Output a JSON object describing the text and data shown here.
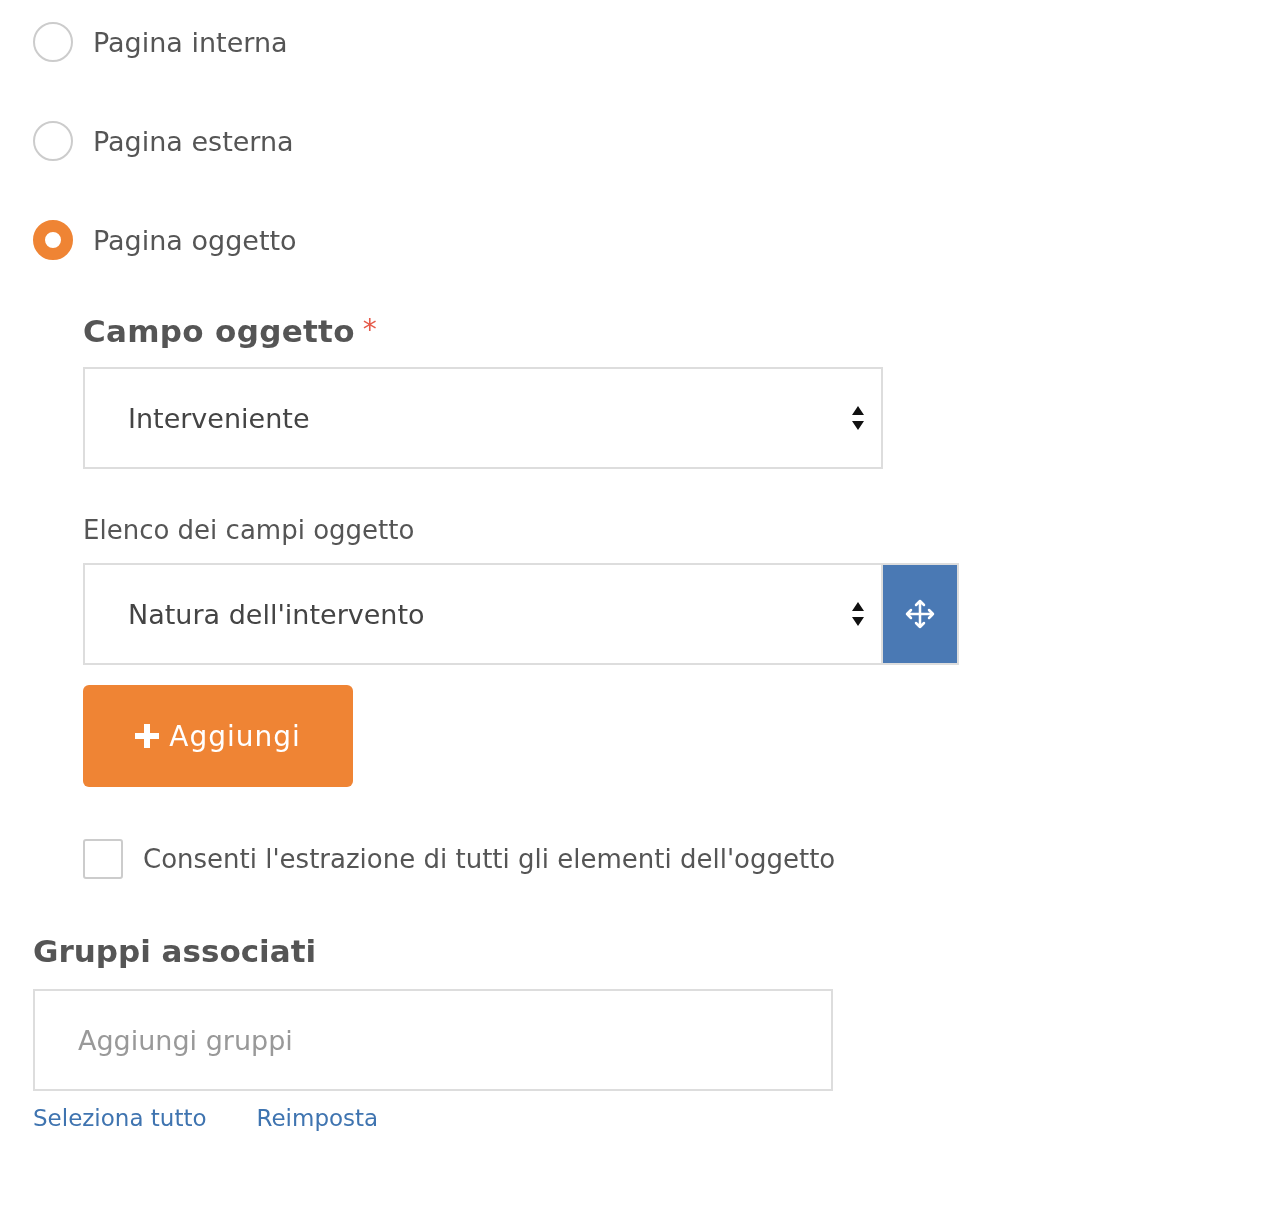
{
  "link_type": [
    {
      "label": "Pagina interna",
      "selected": false
    },
    {
      "label": "Pagina esterna",
      "selected": false
    },
    {
      "label": "Pagina oggetto",
      "selected": true
    }
  ],
  "object_field": {
    "label": "Campo oggetto",
    "required_mark": "*",
    "value": "Interveniente"
  },
  "object_fields_list": {
    "label": "Elenco dei campi oggetto",
    "items": [
      {
        "value": "Natura dell'intervento"
      }
    ]
  },
  "add_button": {
    "label": "Aggiungi"
  },
  "allow_extraction": {
    "label": "Consenti l'estrazione di tutti gli elementi dell'oggetto",
    "checked": false
  },
  "groups": {
    "label": "Gruppi associati",
    "placeholder": "Aggiungi gruppi",
    "links": [
      "Seleziona tutto",
      "Reimposta"
    ]
  }
}
